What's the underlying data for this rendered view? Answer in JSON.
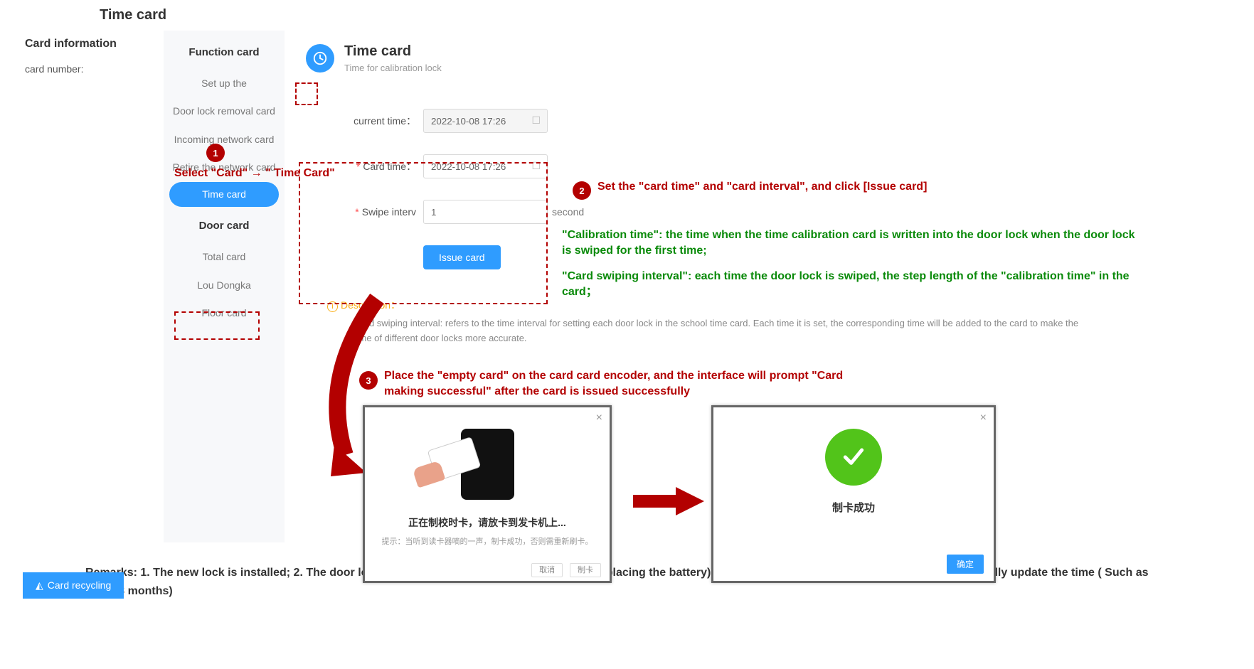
{
  "doc_title": "Time card",
  "left": {
    "heading": "Card information",
    "card_number_label": "card number:"
  },
  "sidebar": {
    "group1": "Function card",
    "items1": [
      "Set up the",
      "Door lock removal card",
      "Incoming network card",
      "Retire the network card",
      "Time card"
    ],
    "group2": "Door card",
    "items2": [
      "Total card",
      "Lou Dongka",
      "Floor card"
    ]
  },
  "page": {
    "title": "Time card",
    "subtitle": "Time for calibration lock"
  },
  "form": {
    "current_time_label": "current time：",
    "current_time_value": "2022-10-08 17:26",
    "card_time_label": "Card time：",
    "card_time_value": "2022-10-08 17:26",
    "swipe_label": "Swipe interv",
    "swipe_value": "1",
    "swipe_unit": "second",
    "issue_btn": "Issue card"
  },
  "desc": {
    "head": "Description：",
    "body": "Card swiping interval: refers to the time interval for setting each door lock in the school time card. Each time it is set, the corresponding time will be added to the card to make the time of different door locks more accurate."
  },
  "recycle_btn": "Card recycling",
  "anno": {
    "n1": "1",
    "n2": "2",
    "n3": "3",
    "step1": "Select \"Card\" → \" Time Card\"",
    "step1_arrow": "→",
    "step2": "Set the \"card time\" and \"card interval\", and click [Issue card]",
    "step2_g1": "\"Calibration time\": the time when the time calibration card is written into the door lock when the door lock is swiped for the first time;",
    "step2_g2": "\"Card swiping interval\": each time the door lock is swiped, the step length of the \"calibration time\" in the card；",
    "step3": "Place the \"empty card\" on the card card encoder, and the interface will prompt \"Card making successful\" after the card is issued successfully"
  },
  "modal1": {
    "t1": "正在制校时卡，请放卡到发卡机上...",
    "t2": "提示：当听到读卡器嘀的一声，制卡成功，否则需重新刷卡。",
    "cancel": "取消",
    "ok": "制卡"
  },
  "modal2": {
    "t1": "制卡成功",
    "ok": "确定"
  },
  "remarks": "Remarks: 1. The new lock is installed; 2. The door lock is powered off for a long time (such as replacing the battery); 3. The door lock runs for a long time, and periodically update the time ( Such as every 3 months)"
}
